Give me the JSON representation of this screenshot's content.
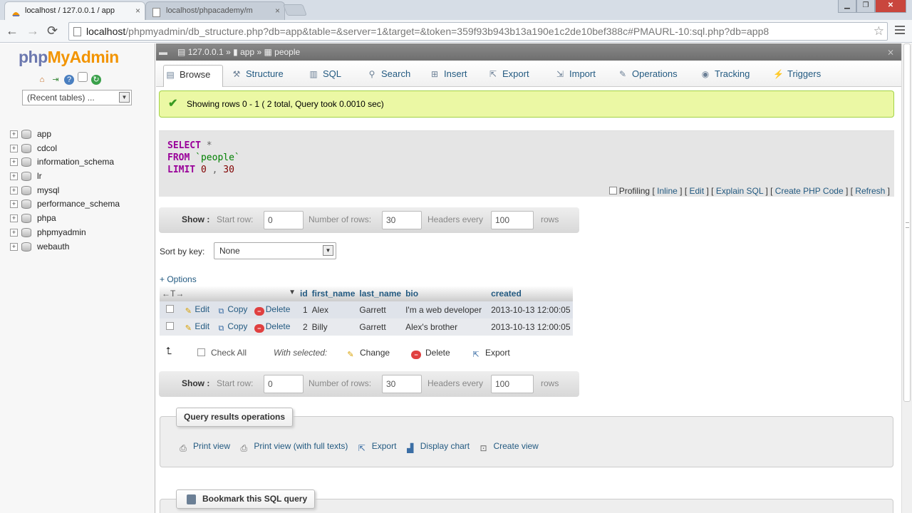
{
  "browser": {
    "tabs": [
      {
        "label": "localhost / 127.0.0.1 / app",
        "active": true
      },
      {
        "label": "localhost/phpacademy/m",
        "active": false
      }
    ],
    "url_host": "localhost",
    "url_path": "/phpmyadmin/db_structure.php?db=app&table=&server=1&target=&token=359f93b943b13a190e1c2de10bef388c#PMAURL-10:sql.php?db=app8"
  },
  "sidebar": {
    "logo": {
      "php": "php",
      "my": "My",
      "admin": "Admin"
    },
    "recent_tables": "(Recent tables) ...",
    "databases": [
      "app",
      "cdcol",
      "information_schema",
      "lr",
      "mysql",
      "performance_schema",
      "phpa",
      "phpmyadmin",
      "webauth"
    ]
  },
  "breadcrumb": {
    "server": "127.0.0.1",
    "sep1": "»",
    "db": "app",
    "sep2": "»",
    "table": "people"
  },
  "tabs": [
    "Browse",
    "Structure",
    "SQL",
    "Search",
    "Insert",
    "Export",
    "Import",
    "Operations",
    "Tracking",
    "Triggers"
  ],
  "success_message": "Showing rows 0 - 1 ( 2 total, Query took 0.0010 sec)",
  "sql": {
    "select": "SELECT",
    "star": "*",
    "from": "FROM",
    "table": "`people`",
    "limit": "LIMIT",
    "limit_start": "0",
    "comma": ",",
    "limit_count": "30"
  },
  "sql_links": {
    "profiling": "Profiling",
    "inline": "Inline",
    "edit": "Edit",
    "explain": "Explain SQL",
    "create_php": "Create PHP Code",
    "refresh": "Refresh"
  },
  "nav": {
    "show_label": "Show :",
    "start_row_label": "Start row:",
    "start_row_value": "0",
    "number_rows_label": "Number of rows:",
    "number_rows_value": "30",
    "headers_every_label": "Headers every",
    "headers_every_value": "100",
    "rows_label": "rows"
  },
  "sort": {
    "label": "Sort by key:",
    "value": "None"
  },
  "options_link": "+ Options",
  "table": {
    "arrows": "←T→",
    "columns": [
      "id",
      "first_name",
      "last_name",
      "bio",
      "created"
    ],
    "actions": {
      "edit": "Edit",
      "copy": "Copy",
      "delete": "Delete"
    },
    "rows": [
      {
        "id": "1",
        "first_name": "Alex",
        "last_name": "Garrett",
        "bio": "I'm a web developer",
        "created": "2013-10-13 12:00:05"
      },
      {
        "id": "2",
        "first_name": "Billy",
        "last_name": "Garrett",
        "bio": "Alex's brother",
        "created": "2013-10-13 12:00:05"
      }
    ]
  },
  "bulk": {
    "check_all": "Check All",
    "with_selected": "With selected:",
    "change": "Change",
    "delete": "Delete",
    "export": "Export"
  },
  "query_ops": {
    "legend": "Query results operations",
    "print_view": "Print view",
    "print_view_full": "Print view (with full texts)",
    "export": "Export",
    "display_chart": "Display chart",
    "create_view": "Create view"
  },
  "bookmark": {
    "legend": "Bookmark this SQL query"
  }
}
